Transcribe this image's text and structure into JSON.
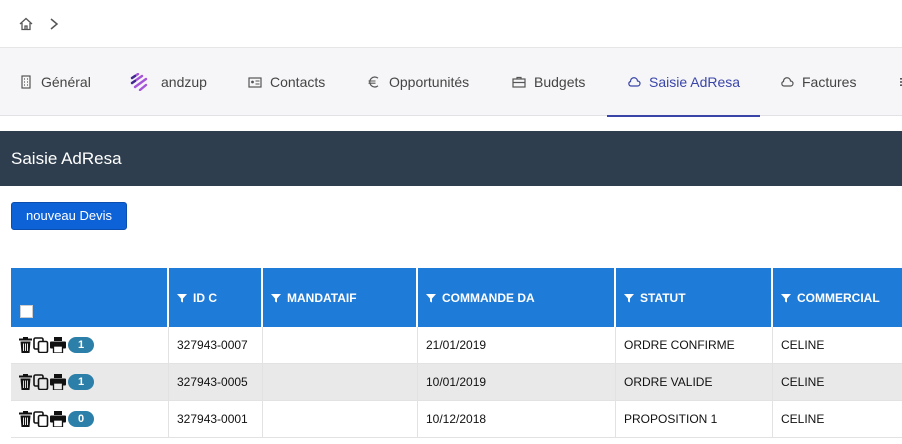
{
  "breadcrumb": {
    "home_icon": "home-icon",
    "separator_icon": "chevron-right-icon"
  },
  "tabs": [
    {
      "label": "Général",
      "icon": "building-icon"
    },
    {
      "label": "andzup",
      "icon": "andzup-logo-icon"
    },
    {
      "label": "Contacts",
      "icon": "contact-card-icon"
    },
    {
      "label": "Opportunités",
      "icon": "euro-icon"
    },
    {
      "label": "Budgets",
      "icon": "briefcase-icon"
    },
    {
      "label": "Saisie AdResa",
      "icon": "cloud-icon",
      "active": true
    },
    {
      "label": "Factures",
      "icon": "cloud-icon"
    },
    {
      "label": "",
      "icon": "more-icon"
    }
  ],
  "section": {
    "title": "Saisie AdResa"
  },
  "toolbar": {
    "new_quote_label": "nouveau Devis"
  },
  "grid": {
    "columns": [
      "ID C",
      "MANDATAIF",
      "COMMANDE DA",
      "STATUT",
      "COMMERCIAL"
    ],
    "rows": [
      {
        "count": "1",
        "id": "327943-0007",
        "mandataire": "",
        "date": "21/01/2019",
        "statut": "ORDRE CONFIRME",
        "commercial": "CELINE"
      },
      {
        "count": "1",
        "id": "327943-0005",
        "mandataire": "",
        "date": "10/01/2019",
        "statut": "ORDRE VALIDE",
        "commercial": "CELINE"
      },
      {
        "count": "0",
        "id": "327943-0001",
        "mandataire": "",
        "date": "10/12/2018",
        "statut": "PROPOSITION 1",
        "commercial": "CELINE"
      }
    ]
  },
  "colors": {
    "header_band": "#2f3e4e",
    "grid_header": "#1f7bd8",
    "button": "#0d62d8",
    "active_tab": "#3a45a8",
    "badge": "#2c7fa8"
  }
}
